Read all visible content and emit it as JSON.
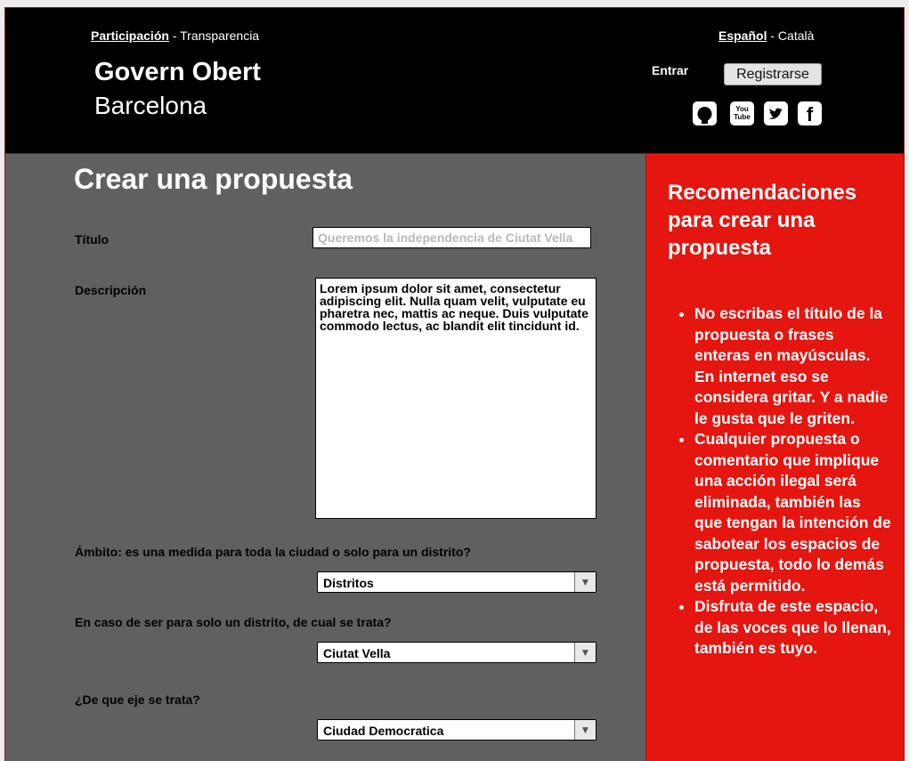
{
  "topnav": {
    "active": "Participación",
    "separator": " - ",
    "other": "Transparencia"
  },
  "brand": {
    "title": "Govern Obert",
    "subtitle": "Barcelona"
  },
  "lang": {
    "active": "Español",
    "separator": " - ",
    "other": "Català"
  },
  "auth": {
    "login": "Entrar",
    "register": "Registrarse"
  },
  "social": {
    "github": "github-icon",
    "youtube_text": "You Tube",
    "twitter": "twitter-icon",
    "facebook": "f"
  },
  "form": {
    "title": "Crear una propuesta",
    "titulo_label": "Título",
    "titulo_placeholder": "Queremos la independencia de Ciutat Vella",
    "descripcion_label": "Descripción",
    "descripcion_value": "Lorem ipsum dolor sit amet, consectetur adipiscing elit. Nulla quam velit, vulputate eu pharetra nec, mattis ac neque. Duis vulputate commodo lectus, ac blandit elit tincidunt id.",
    "ambito_label": "Ámbito: es una medida para toda la ciudad o solo para un distrito?",
    "ambito_value": "Distritos",
    "distrito_label": "En caso de ser para solo un distrito, de cual se trata?",
    "distrito_value": "Ciutat Vella",
    "eje_label": "¿De que eje se trata?",
    "eje_value": "Ciudad Democratica"
  },
  "sidebar": {
    "title": "Recomendaciones para crear una propuesta",
    "items": [
      "No escribas el título de la propuesta o frases enteras en mayúsculas. En internet eso se considera gritar. Y a nadie le gusta que le griten.",
      "Cualquier propuesta o comentario que implique una acción ilegal será eliminada, también las que tengan la intención de sabotear los espacios de propuesta, todo lo demás está permitido.",
      "Disfruta de este espacio, de las voces que lo llenan, también es tuyo."
    ]
  },
  "colors": {
    "header_bg": "#000000",
    "content_bg": "#606060",
    "sidebar_bg": "#e51510"
  }
}
